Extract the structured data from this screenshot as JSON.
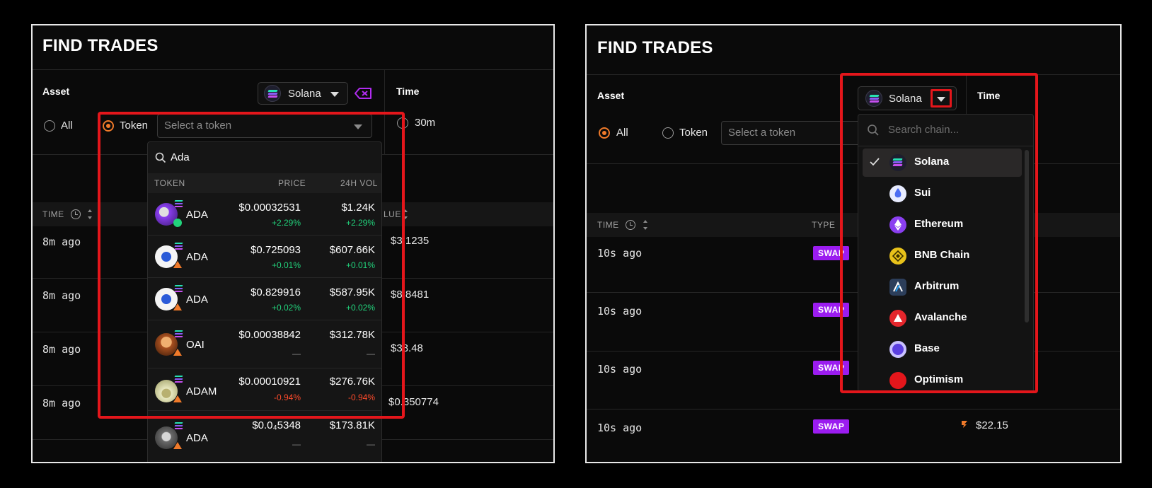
{
  "left": {
    "title": "FIND TRADES",
    "asset_label": "Asset",
    "time_label": "Time",
    "chain_selected": "Solana",
    "radio_all": "All",
    "radio_token": "Token",
    "token_placeholder": "Select a token",
    "time_option": "30m",
    "table_headers": {
      "time": "TIME",
      "value": "LUE"
    },
    "rows": [
      {
        "time": "8m ago",
        "value": "$3.1235"
      },
      {
        "time": "8m ago",
        "value": "$8.8481"
      },
      {
        "time": "8m ago",
        "value": "$38.48"
      },
      {
        "time": "8m ago",
        "value": "$0.350774"
      }
    ],
    "token_dropdown": {
      "search_value": "Ada",
      "headers": {
        "token": "TOKEN",
        "price": "PRICE",
        "vol": "24H VOL"
      },
      "tokens": [
        {
          "name": "ADA",
          "price": "$0.00032531",
          "price_chg": "+2.29%",
          "vol": "$1.24K",
          "vol_chg": "+2.29%",
          "trend": "pos",
          "badge": "verified"
        },
        {
          "name": "ADA",
          "price": "$0.725093",
          "price_chg": "+0.01%",
          "vol": "$607.66K",
          "vol_chg": "+0.01%",
          "trend": "pos",
          "badge": "warning"
        },
        {
          "name": "ADA",
          "price": "$0.829916",
          "price_chg": "+0.02%",
          "vol": "$587.95K",
          "vol_chg": "+0.02%",
          "trend": "pos",
          "badge": "warning"
        },
        {
          "name": "OAI",
          "price": "$0.00038842",
          "price_chg": "—",
          "vol": "$312.78K",
          "vol_chg": "—",
          "trend": "dash",
          "badge": "warning"
        },
        {
          "name": "ADAM",
          "price": "$0.00010921",
          "price_chg": "-0.94%",
          "vol": "$276.76K",
          "vol_chg": "-0.94%",
          "trend": "neg",
          "badge": "warning"
        },
        {
          "name": "ADA",
          "price": "$0.0₄5348",
          "price_chg": "—",
          "vol": "$173.81K",
          "vol_chg": "—",
          "trend": "dash",
          "badge": "warning"
        }
      ]
    }
  },
  "right": {
    "title": "FIND TRADES",
    "asset_label": "Asset",
    "time_label": "Time",
    "chain_selected": "Solana",
    "radio_all": "All",
    "radio_token": "Token",
    "token_placeholder": "Select a token",
    "table_headers": {
      "time": "TIME",
      "type": "TYPE"
    },
    "rows": [
      {
        "time": "10s ago",
        "type": "SWAP",
        "value": ""
      },
      {
        "time": "10s ago",
        "type": "SWAP",
        "value": ""
      },
      {
        "time": "10s ago",
        "type": "SWAP",
        "value": ""
      },
      {
        "time": "10s ago",
        "type": "SWAP",
        "value": "$22.15"
      }
    ],
    "chain_dropdown": {
      "search_placeholder": "Search chain...",
      "chains": [
        {
          "name": "Solana",
          "icon": "solana-icon",
          "color": "#1e1e2e",
          "selected": true
        },
        {
          "name": "Sui",
          "icon": "sui-icon",
          "color": "#e8ecff",
          "selected": false
        },
        {
          "name": "Ethereum",
          "icon": "ethereum-icon",
          "color": "#8a3ff0",
          "selected": false
        },
        {
          "name": "BNB Chain",
          "icon": "bnb-icon",
          "color": "#e8c21a",
          "selected": false
        },
        {
          "name": "Arbitrum",
          "icon": "arbitrum-icon",
          "color": "#2c3e5a",
          "selected": false
        },
        {
          "name": "Avalanche",
          "icon": "avalanche-icon",
          "color": "#e4262c",
          "selected": false
        },
        {
          "name": "Base",
          "icon": "base-icon",
          "color": "#c9c2ff",
          "selected": false
        },
        {
          "name": "Optimism",
          "icon": "optimism-icon",
          "color": "#e4161b",
          "selected": false
        }
      ]
    }
  },
  "colors": {
    "accent_orange": "#f07a2a",
    "swap_purple": "#9b1cf0",
    "positive": "#22d37c",
    "negative": "#ff4b2b",
    "highlight_red": "#e4161b"
  }
}
